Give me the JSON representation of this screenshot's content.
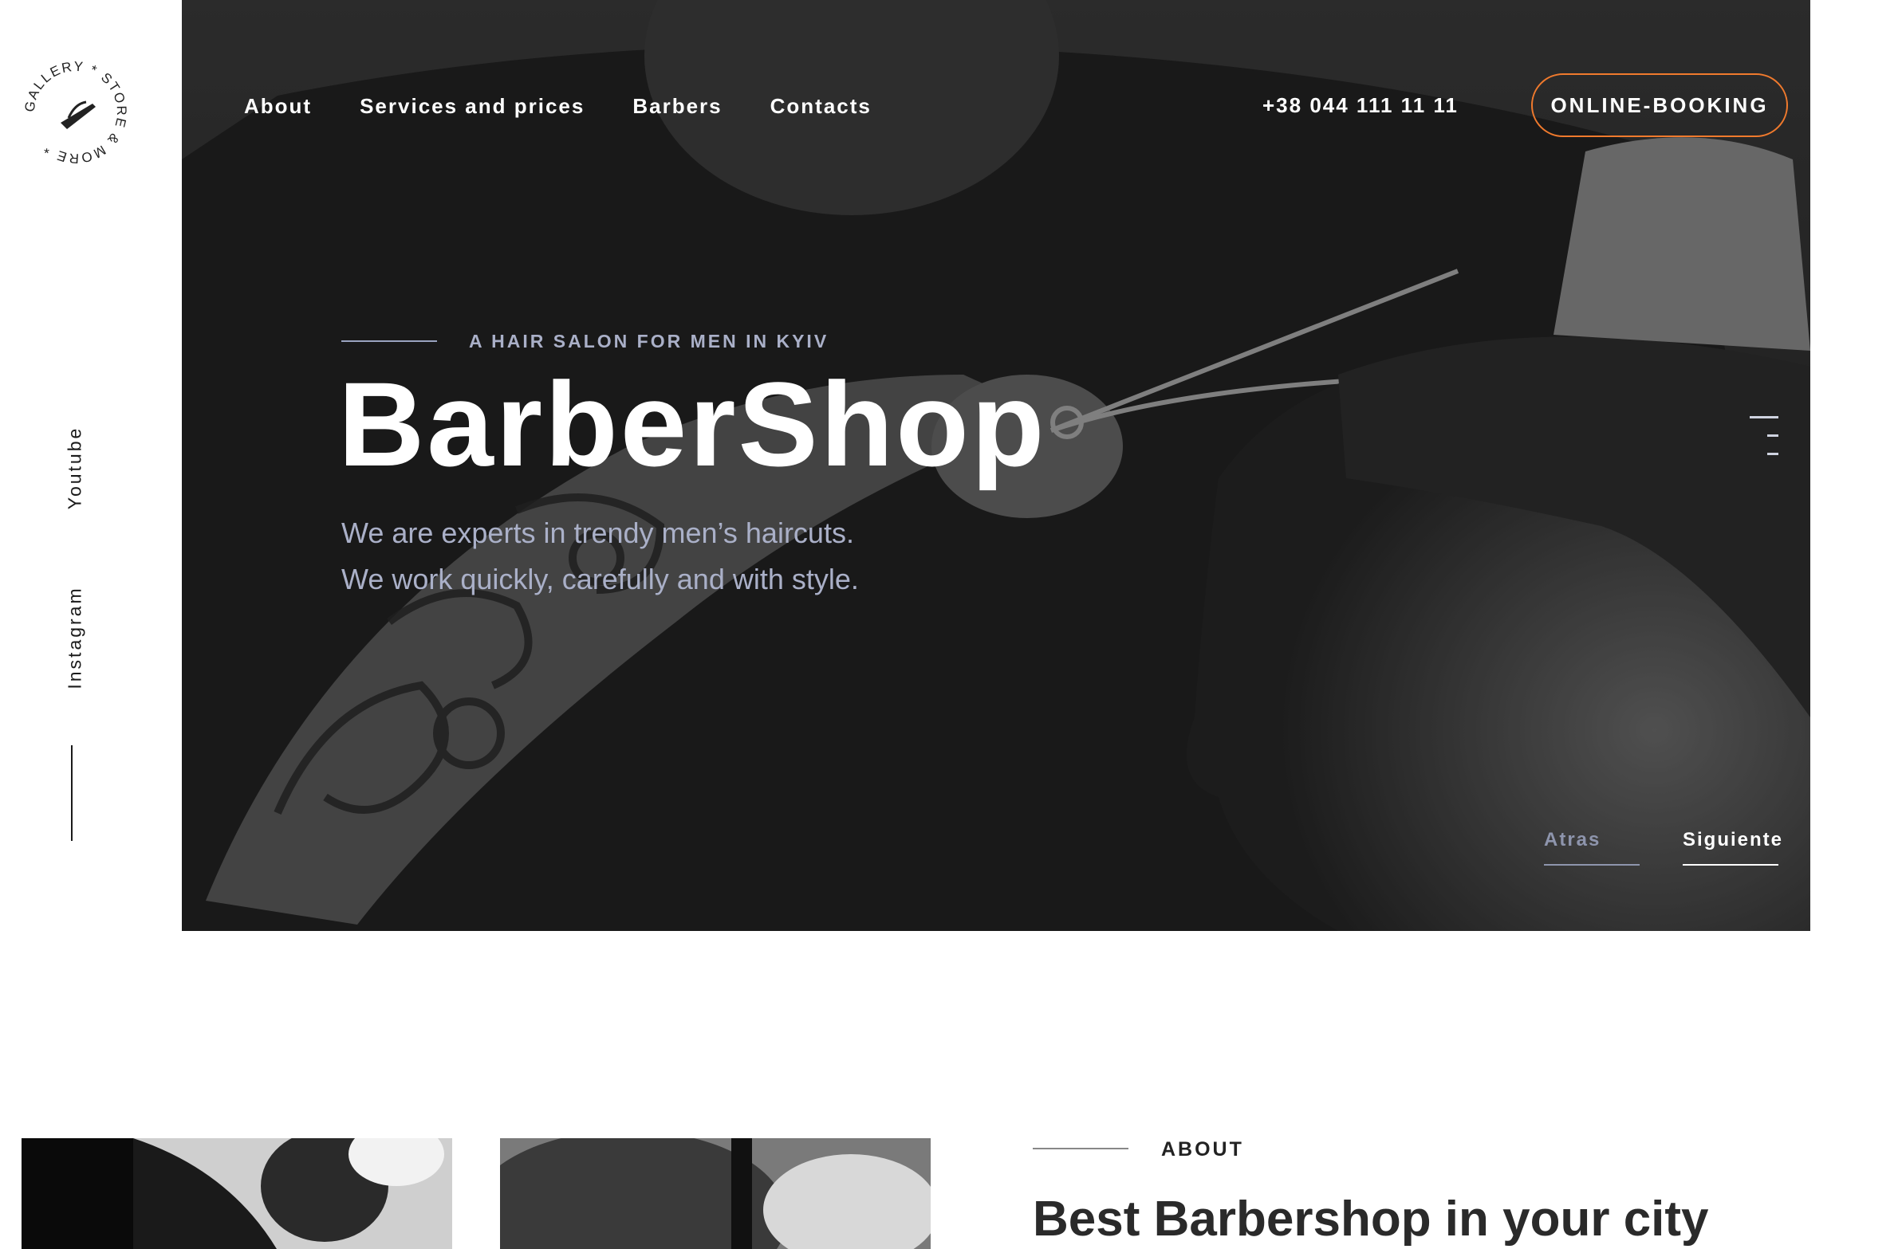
{
  "logo": {
    "ring_text": "GALLERY * STORE & MORE *"
  },
  "social": {
    "youtube": "Youtube",
    "instagram": "Instagram"
  },
  "nav": {
    "items": [
      {
        "label": "About"
      },
      {
        "label": "Services and prices"
      },
      {
        "label": "Barbers"
      },
      {
        "label": "Contacts"
      }
    ],
    "phone": "+38 044 111 11 11",
    "booking": "ONLINE-BOOKING"
  },
  "hero": {
    "eyebrow": "A HAIR SALON FOR MEN IN KYIV",
    "title": "BarberShop",
    "subtitle_line1": "We are experts in trendy men’s haircuts.",
    "subtitle_line2": "We work quickly, carefully and with style.",
    "prev": "Atras",
    "next": "Siguiente"
  },
  "about": {
    "label": "ABOUT",
    "title": "Best Barbershop in your city"
  },
  "colors": {
    "accent": "#f07a2d",
    "muted_text": "#aab0c8",
    "hero_bg": "#2b2b2b"
  }
}
